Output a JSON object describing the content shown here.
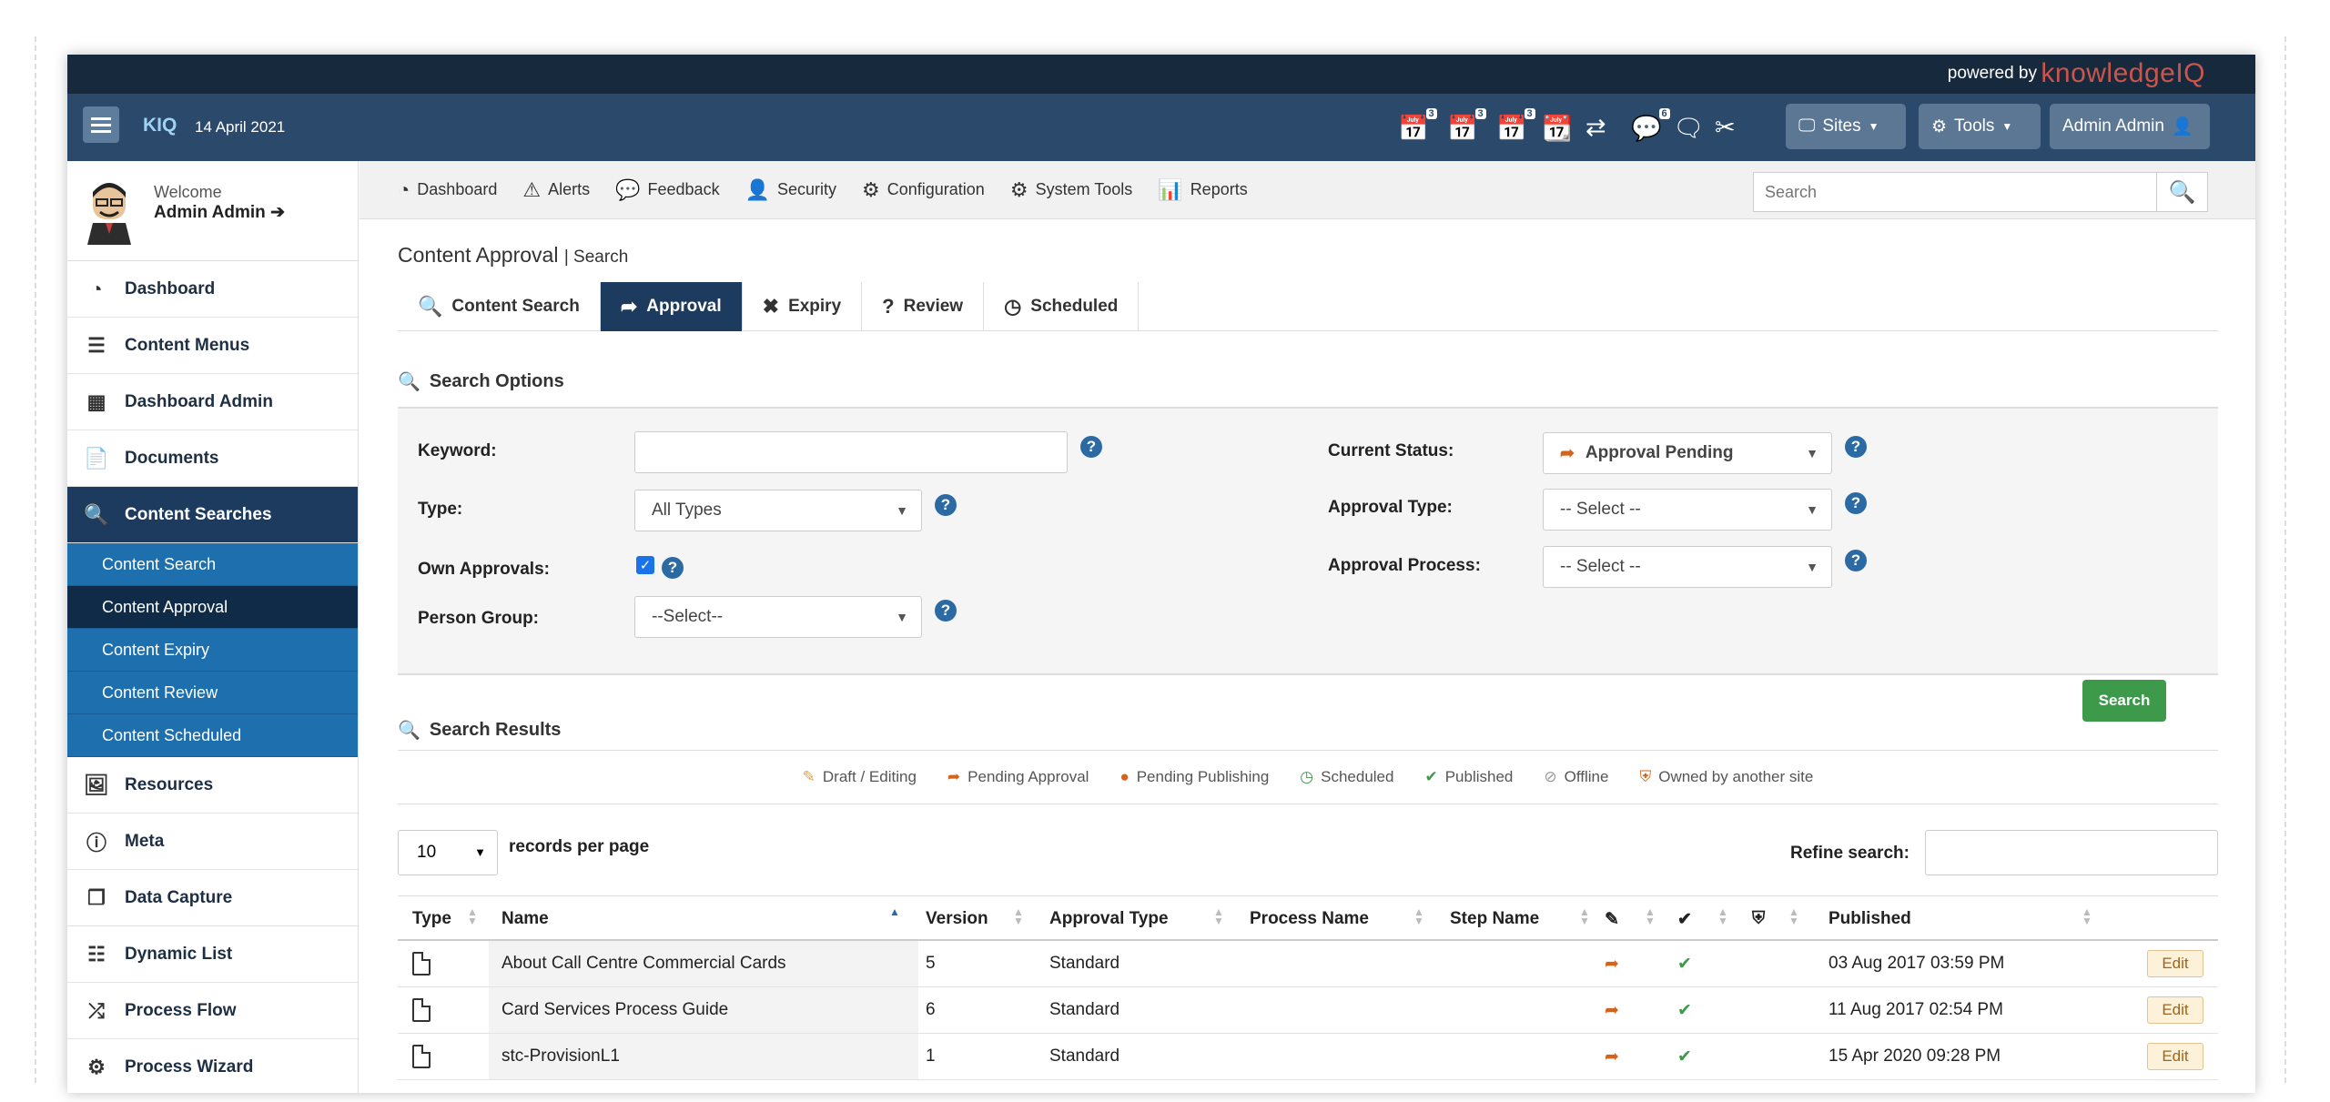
{
  "powered": {
    "by": "powered by",
    "brand": "knowledgeIQ"
  },
  "header": {
    "brand": "KIQ",
    "date": "14 April 2021",
    "badges": {
      "approvals": "3",
      "expiry": "3",
      "review": "3",
      "messages": "6"
    },
    "sites_label": "Sites",
    "tools_label": "Tools",
    "user_label": "Admin Admin"
  },
  "sidebar": {
    "welcome": "Welcome",
    "user_name": "Admin Admin ➔",
    "items": [
      {
        "label": "Dashboard"
      },
      {
        "label": "Content Menus"
      },
      {
        "label": "Dashboard Admin"
      },
      {
        "label": "Documents"
      },
      {
        "label": "Content Searches"
      },
      {
        "label": "Resources"
      },
      {
        "label": "Meta"
      },
      {
        "label": "Data Capture"
      },
      {
        "label": "Dynamic List"
      },
      {
        "label": "Process Flow"
      },
      {
        "label": "Process Wizard"
      }
    ],
    "subitems": [
      {
        "label": "Content Search"
      },
      {
        "label": "Content Approval"
      },
      {
        "label": "Content Expiry"
      },
      {
        "label": "Content Review"
      },
      {
        "label": "Content Scheduled"
      }
    ]
  },
  "topnav": {
    "items": [
      "Dashboard",
      "Alerts",
      "Feedback",
      "Security",
      "Configuration",
      "System Tools",
      "Reports"
    ],
    "search_placeholder": "Search"
  },
  "page": {
    "title": "Content Approval",
    "subtitle": "| Search",
    "tabs": [
      "Content Search",
      "Approval",
      "Expiry",
      "Review",
      "Scheduled"
    ]
  },
  "search_options": {
    "heading": "Search Options",
    "keyword_label": "Keyword:",
    "keyword_value": "",
    "type_label": "Type:",
    "type_value": "All Types",
    "own_approvals_label": "Own Approvals:",
    "own_approvals_checked": true,
    "person_group_label": "Person Group:",
    "person_group_value": "--Select--",
    "current_status_label": "Current Status:",
    "current_status_value": "Approval Pending",
    "approval_type_label": "Approval Type:",
    "approval_type_value": "-- Select --",
    "approval_process_label": "Approval Process:",
    "approval_process_value": "-- Select --",
    "search_button": "Search"
  },
  "results": {
    "heading": "Search Results",
    "legend": [
      "Draft / Editing",
      "Pending Approval",
      "Pending Publishing",
      "Scheduled",
      "Published",
      "Offline",
      "Owned by another site"
    ],
    "records_per_page_value": "10",
    "records_per_page_label": "records per page",
    "refine_label": "Refine search:",
    "columns": [
      "Type",
      "Name",
      "Version",
      "Approval Type",
      "Process Name",
      "Step Name",
      "Published"
    ],
    "rows": [
      {
        "name": "About Call Centre Commercial Cards",
        "version": "5",
        "approval_type": "Standard",
        "process_name": "",
        "step_name": "",
        "published": "03 Aug 2017 03:59 PM",
        "edit": "Edit"
      },
      {
        "name": "Card Services Process Guide",
        "version": "6",
        "approval_type": "Standard",
        "process_name": "",
        "step_name": "",
        "published": "11 Aug 2017 02:54 PM",
        "edit": "Edit"
      },
      {
        "name": "stc-ProvisionL1",
        "version": "1",
        "approval_type": "Standard",
        "process_name": "",
        "step_name": "",
        "published": "15 Apr 2020 09:28 PM",
        "edit": "Edit"
      }
    ]
  },
  "colors": {
    "header_bg": "#2b4a6b",
    "nav_active": "#1c3b5f",
    "sub_nav": "#1d6fae",
    "search_green": "#3c9a4a",
    "pending_orange": "#d4631d"
  }
}
